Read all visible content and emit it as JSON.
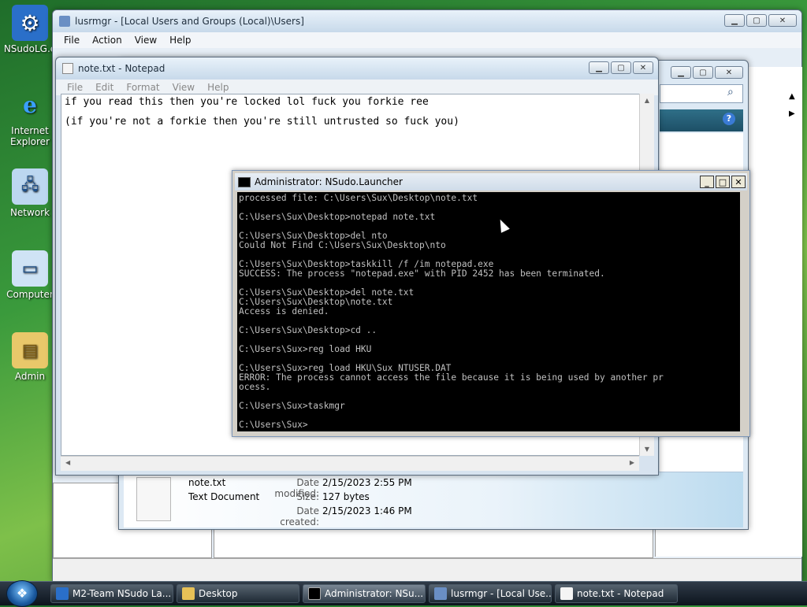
{
  "desktop": {
    "icons": [
      {
        "label": "NSudoLG.e",
        "icon": "nsudo-app-icon"
      },
      {
        "label": "Internet Explorer",
        "icon": "internet-explorer-icon"
      },
      {
        "label": "Network",
        "icon": "network-icon"
      },
      {
        "label": "Computer",
        "icon": "computer-icon"
      },
      {
        "label": "Admin",
        "icon": "user-folder-icon"
      }
    ]
  },
  "lusrmgr": {
    "title": "lusrmgr - [Local Users and Groups (Local)\\Users]",
    "menu": [
      "File",
      "Action",
      "View",
      "Help"
    ]
  },
  "explorer": {
    "file_name": "note.txt",
    "file_type": "Text Document",
    "date_modified_label": "Date modified:",
    "date_modified": "2/15/2023 2:55 PM",
    "size_label": "Size:",
    "size": "127 bytes",
    "date_created_label": "Date created:",
    "date_created": "2/15/2023 1:46 PM"
  },
  "notepad": {
    "title": "note.txt - Notepad",
    "menu": [
      "File",
      "Edit",
      "Format",
      "View",
      "Help"
    ],
    "lines": [
      "if you read this then you're locked lol fuck you forkie ree",
      "(if you're not a forkie then you're still untrusted so fuck you)"
    ]
  },
  "console": {
    "title": "Administrator: NSudo.Launcher",
    "text": "processed file: C:\\Users\\Sux\\Desktop\\note.txt\n\nC:\\Users\\Sux\\Desktop>notepad note.txt\n\nC:\\Users\\Sux\\Desktop>del nto\nCould Not Find C:\\Users\\Sux\\Desktop\\nto\n\nC:\\Users\\Sux\\Desktop>taskkill /f /im notepad.exe\nSUCCESS: The process \"notepad.exe\" with PID 2452 has been terminated.\n\nC:\\Users\\Sux\\Desktop>del note.txt\nC:\\Users\\Sux\\Desktop\\note.txt\nAccess is denied.\n\nC:\\Users\\Sux\\Desktop>cd ..\n\nC:\\Users\\Sux>reg load HKU\n\nC:\\Users\\Sux>reg load HKU\\Sux NTUSER.DAT\nERROR: The process cannot access the file because it is being used by another pr\nocess.\n\nC:\\Users\\Sux>taskmgr\n\nC:\\Users\\Sux>"
  },
  "taskbar": {
    "items": [
      {
        "label": "M2-Team NSudo La...",
        "icon": "nsudo-app-icon"
      },
      {
        "label": "Desktop",
        "icon": "folder-icon"
      },
      {
        "label": "Administrator: NSu...",
        "icon": "console-icon"
      },
      {
        "label": "lusrmgr - [Local Use...",
        "icon": "users-icon"
      },
      {
        "label": "note.txt - Notepad",
        "icon": "notepad-icon"
      }
    ]
  },
  "colors": {
    "console_bg": "#000000",
    "console_fg": "#c0c0c0",
    "taskbar": "#1a2430"
  }
}
